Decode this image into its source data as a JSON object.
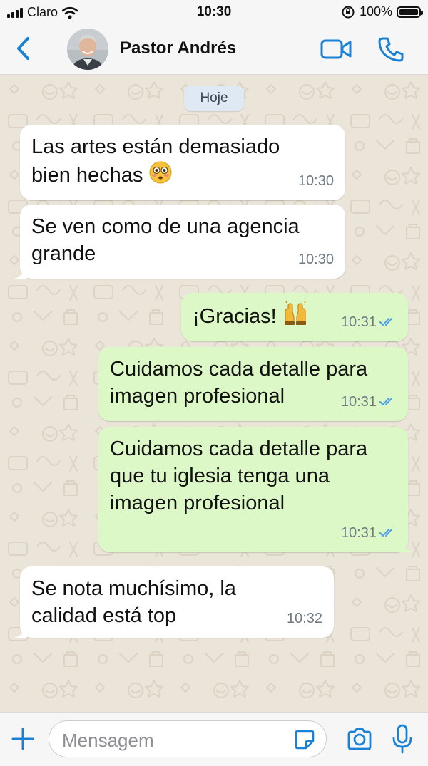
{
  "status_bar": {
    "carrier": "Claro",
    "time": "10:30",
    "battery_percent": "100%",
    "icons": [
      "signal-icon",
      "wifi-icon",
      "orientation-lock-icon",
      "battery-icon"
    ]
  },
  "header": {
    "contact_name": "Pastor Andrés",
    "icons": [
      "back-chevron-icon",
      "avatar-photo",
      "video-camera-icon",
      "phone-icon"
    ],
    "accent_color": "#1a82d6"
  },
  "chat": {
    "date_label": "Hoje",
    "messages": [
      {
        "direction": "in",
        "line1": "Las artes están demasiado",
        "line2": "bien hechas",
        "emoji": "😳",
        "time": "10:30"
      },
      {
        "direction": "in",
        "line1": "Se ven como de una agencia",
        "line2": "grande",
        "time": "10:30"
      },
      {
        "direction": "out",
        "line1": "¡Gracias!",
        "emoji": "🙌",
        "time": "10:31",
        "status": "read-double-check"
      },
      {
        "direction": "out",
        "line1": "Cuidamos cada detalle para",
        "line2": "imagen profesional",
        "time": "10:31",
        "status": "read-double-check"
      },
      {
        "direction": "out",
        "line1": "Cuidamos cada detalle para",
        "line2": "que tu iglesia tenga una",
        "line3": "imagen profesional",
        "time": "10:31",
        "status": "read-double-check"
      },
      {
        "direction": "in",
        "line1": "Se nota muchísimo, la",
        "line2": "calidad está top",
        "time": "10:32"
      }
    ],
    "colors": {
      "incoming_bubble": "#ffffff",
      "outgoing_bubble": "#dcf8c6",
      "read_ticks": "#4a9ee8",
      "wallpaper": "#ebe4d8"
    }
  },
  "input_bar": {
    "placeholder": "Mensagem",
    "icons": [
      "plus-icon",
      "sticker-icon",
      "camera-icon",
      "microphone-icon"
    ]
  }
}
